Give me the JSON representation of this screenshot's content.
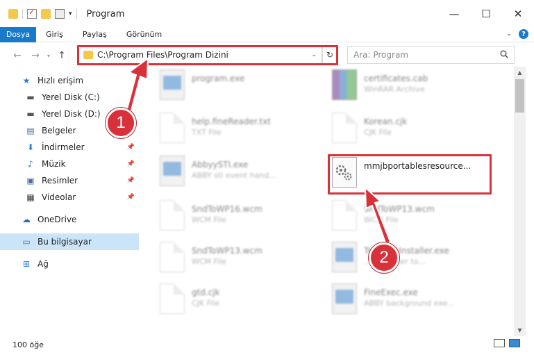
{
  "window": {
    "title": "Program"
  },
  "ribbon": {
    "tabs": [
      {
        "label": "Dosya",
        "active": true
      },
      {
        "label": "Giriş",
        "active": false
      },
      {
        "label": "Paylaş",
        "active": false
      },
      {
        "label": "Görünüm",
        "active": false
      }
    ]
  },
  "address": {
    "path": "C:\\Program Files\\Program Dizini",
    "search_placeholder": "Ara: Program"
  },
  "sidebar": {
    "items": [
      {
        "label": "Hızlı erişim",
        "icon": "star-icon",
        "pinned": false
      },
      {
        "label": "Yerel Disk (C:)",
        "icon": "drive-icon",
        "pinned": false
      },
      {
        "label": "Yerel Disk (D:)",
        "icon": "drive-icon",
        "pinned": false
      },
      {
        "label": "Belgeler",
        "icon": "documents-icon",
        "pinned": true
      },
      {
        "label": "İndirmeler",
        "icon": "download-icon",
        "pinned": true
      },
      {
        "label": "Müzik",
        "icon": "music-icon",
        "pinned": true
      },
      {
        "label": "Resimler",
        "icon": "pictures-icon",
        "pinned": true
      },
      {
        "label": "Videolar",
        "icon": "video-icon",
        "pinned": true
      },
      {
        "label": "OneDrive",
        "icon": "cloud-icon",
        "pinned": false
      },
      {
        "label": "Bu bilgisayar",
        "icon": "computer-icon",
        "pinned": false
      },
      {
        "label": "Ağ",
        "icon": "network-icon",
        "pinned": false
      }
    ]
  },
  "files": [
    {
      "name": "program.exe",
      "type": "",
      "icon": "exe-icon"
    },
    {
      "name": "certificates.cab",
      "type": "WinRAR Archive",
      "icon": "archive-icon"
    },
    {
      "name": "help.fineReader.txt",
      "type": "TXT File",
      "icon": "document-icon"
    },
    {
      "name": "Korean.cjk",
      "type": "CJK File",
      "icon": "document-icon"
    },
    {
      "name": "AbbyySTI.exe",
      "type": "ABBY sti event hand...",
      "icon": "exe-icon"
    },
    {
      "name": "mmjbportablesresource...",
      "type": "",
      "icon": "gear-file-icon"
    },
    {
      "name": "SndToWP16.wcm",
      "type": "WCM File",
      "icon": "document-icon"
    },
    {
      "name": "SndToWP13.wcm",
      "type": "WCM File",
      "icon": "document-icon"
    },
    {
      "name": "SndToWP13.wcm",
      "type": "WCM File",
      "icon": "document-icon"
    },
    {
      "name": "Tr...mmsInstaller.exe",
      "type": "...owsender to...",
      "icon": "exe-icon"
    },
    {
      "name": "gtd.cjk",
      "type": "CJK File",
      "icon": "document-icon"
    },
    {
      "name": "FineExec.exe",
      "type": "ABBY background exe...",
      "icon": "exe-icon"
    }
  ],
  "status": {
    "item_count": "100 öğe"
  },
  "annotations": {
    "badge1": "1",
    "badge2": "2"
  },
  "colors": {
    "accent": "#1979ca",
    "highlight": "#d9313a",
    "selected": "#cce4f7"
  }
}
